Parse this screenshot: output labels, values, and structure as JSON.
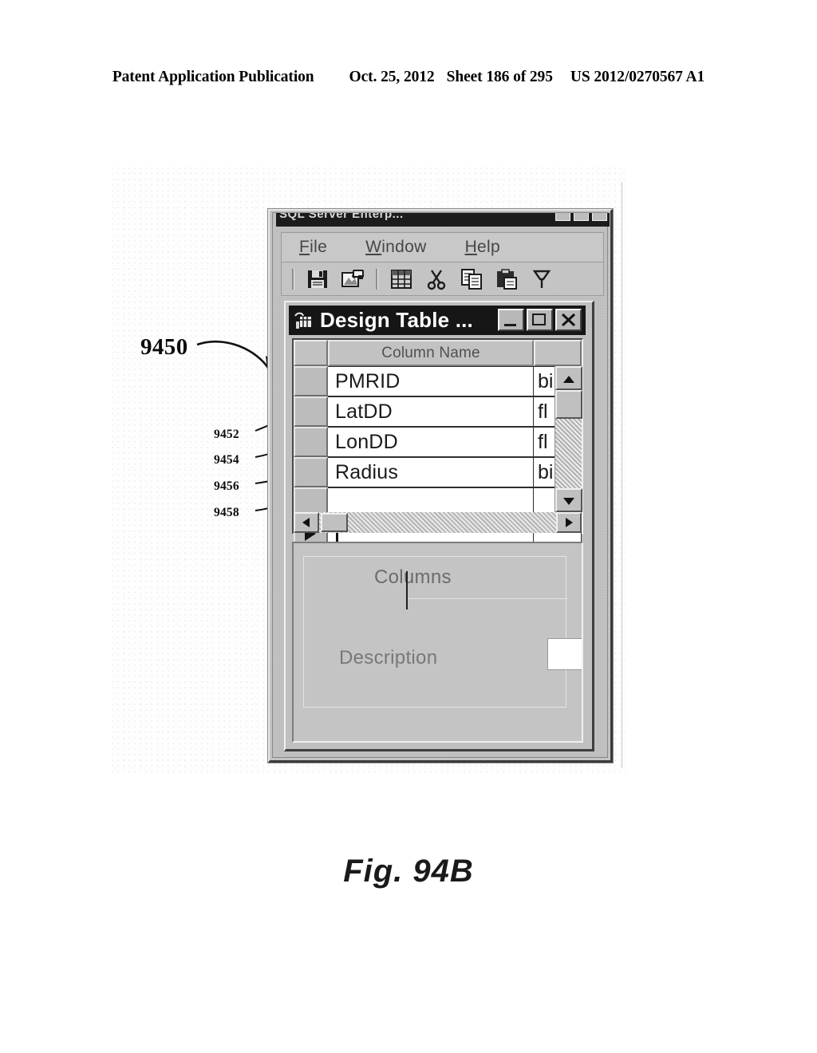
{
  "patent_header": {
    "publication": "Patent Application Publication",
    "date": "Oct. 25, 2012",
    "sheet": "Sheet 186 of 295",
    "number": "US 2012/0270567 A1"
  },
  "figure": {
    "caption": "Fig. 94B",
    "callouts": [
      {
        "id": "9450",
        "target": "design-table-dialog"
      },
      {
        "id": "9452",
        "target": "row-pmrid"
      },
      {
        "id": "9454",
        "target": "row-latdd"
      },
      {
        "id": "9456",
        "target": "row-londd"
      },
      {
        "id": "9458",
        "target": "row-radius"
      }
    ]
  },
  "app_window": {
    "title": "SQL Server Enterp...",
    "titlebar_buttons": [
      "minimize",
      "maximize",
      "close"
    ],
    "menu": [
      {
        "label": "File",
        "accel": "F"
      },
      {
        "label": "Window",
        "accel": "W"
      },
      {
        "label": "Help",
        "accel": "H"
      }
    ],
    "toolbar": [
      {
        "name": "save-icon",
        "title": "Save"
      },
      {
        "name": "properties-icon",
        "title": "Properties"
      },
      {
        "name": "table-grid-icon",
        "title": "Table"
      },
      {
        "name": "cut-icon",
        "title": "Cut"
      },
      {
        "name": "copy-icon",
        "title": "Copy"
      },
      {
        "name": "paste-icon",
        "title": "Paste"
      },
      {
        "name": "filter-icon",
        "title": "Filter"
      }
    ]
  },
  "dialog": {
    "title": "Design Table ...",
    "buttons": {
      "minimize": "_",
      "maximize": "□",
      "close": "✕"
    },
    "grid": {
      "headers": {
        "selector": "",
        "column_name": "Column Name",
        "datatype": ""
      },
      "rows": [
        {
          "name": "PMRID",
          "datatype": "bi",
          "current": false
        },
        {
          "name": "LatDD",
          "datatype": "fl",
          "current": false
        },
        {
          "name": "LonDD",
          "datatype": "fl",
          "current": false
        },
        {
          "name": "Radius",
          "datatype": "bi",
          "current": false
        },
        {
          "name": "",
          "datatype": "",
          "current": false
        },
        {
          "name": "",
          "datatype": "",
          "current": true
        }
      ]
    },
    "scrollbars": {
      "vertical": {
        "up": "▲",
        "down": "▼"
      },
      "horizontal": {
        "left": "◀",
        "right": "▶"
      }
    },
    "lower_pane": {
      "columns_group_label": "Columns",
      "description_label": "Description",
      "description_value": ""
    }
  }
}
